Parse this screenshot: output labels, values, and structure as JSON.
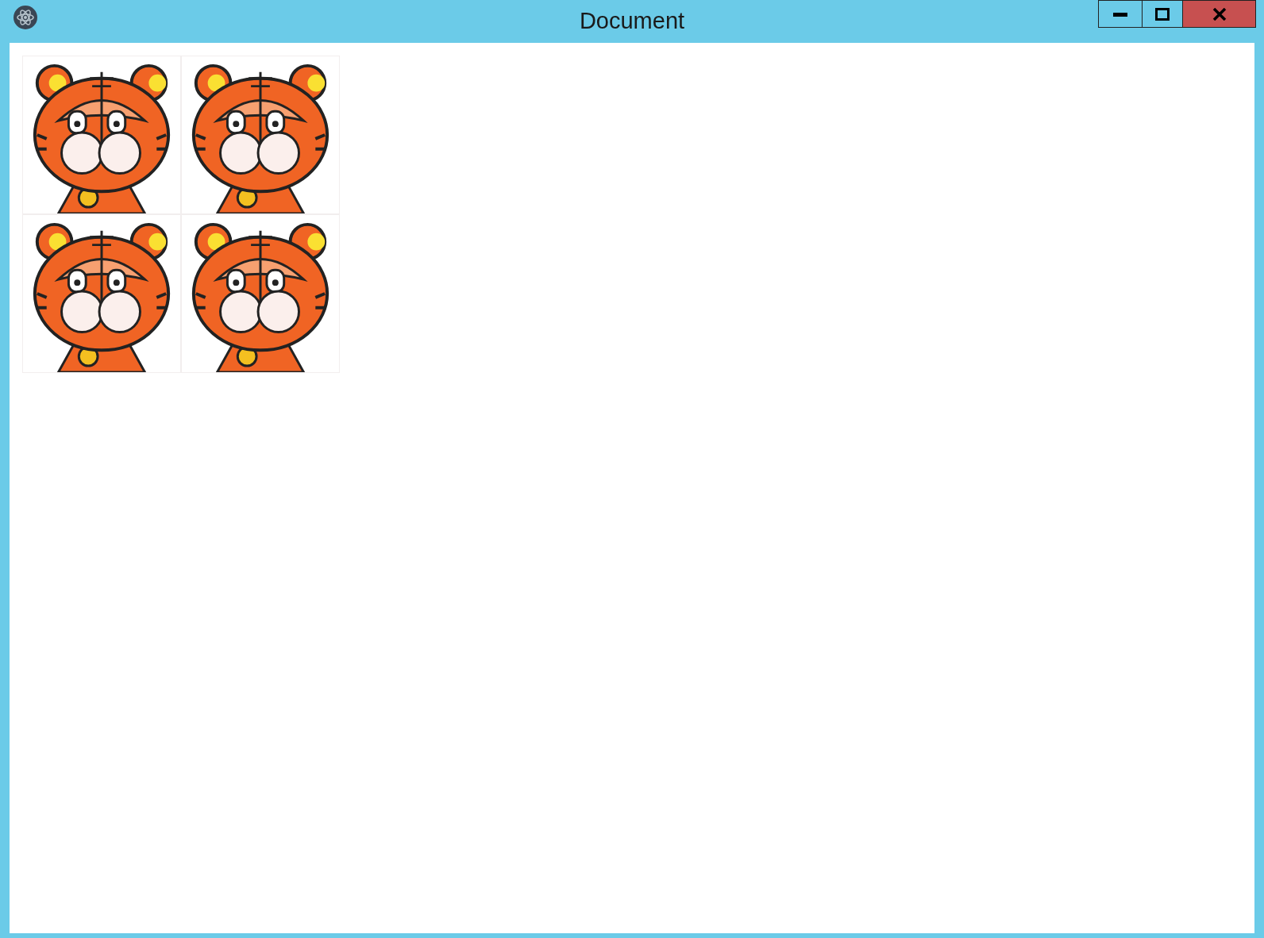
{
  "window": {
    "title": "Document"
  }
}
